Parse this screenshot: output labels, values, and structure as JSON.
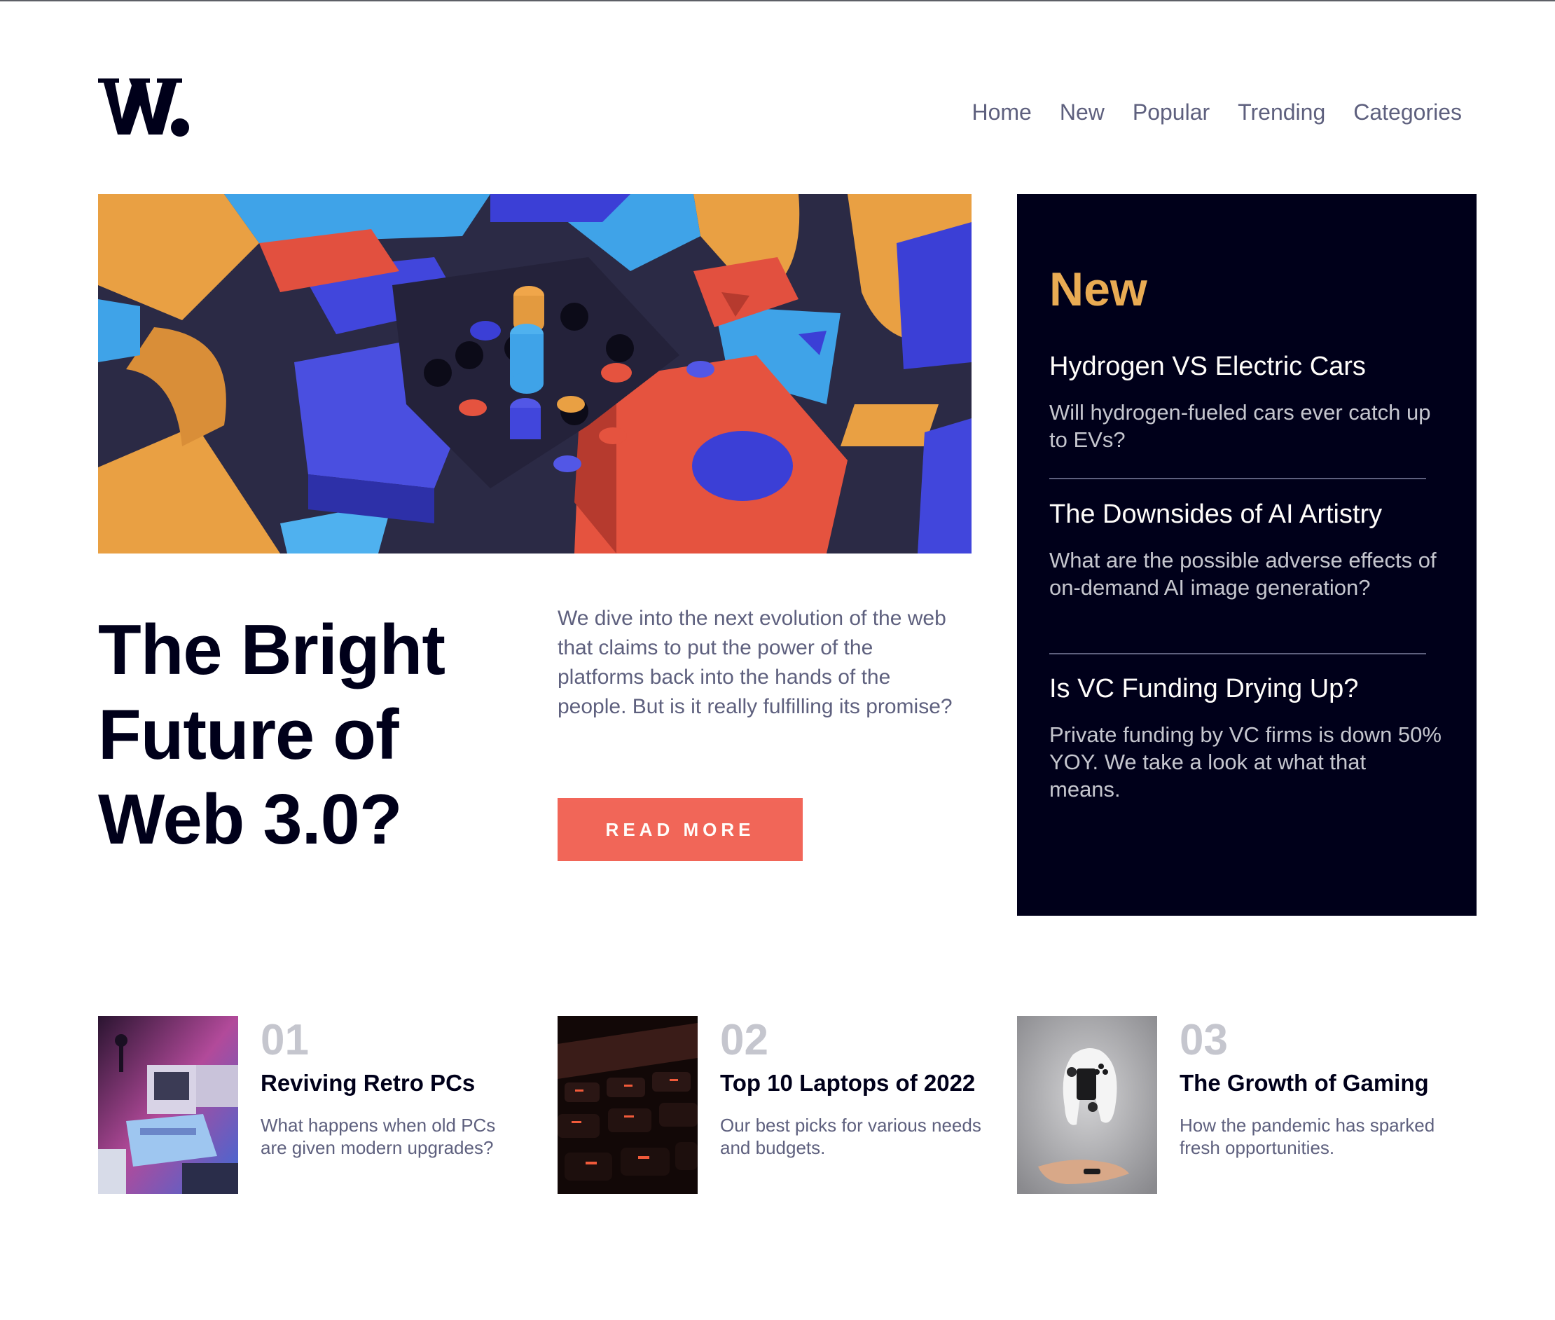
{
  "header": {
    "logo_letter": "W",
    "nav": [
      "Home",
      "New",
      "Popular",
      "Trending",
      "Categories"
    ]
  },
  "hero": {
    "image_alt": "abstract 3D colorful blocks",
    "title": "The Bright Future of Web 3.0?",
    "description": "We dive into the next evolution of the web that claims to put the power of the platforms back into the hands of the people. But is it really fulfilling its promise?",
    "cta_label": "READ MORE"
  },
  "new_panel": {
    "heading": "New",
    "items": [
      {
        "title": "Hydrogen VS Electric Cars",
        "summary": "Will hydrogen-fueled cars ever catch up to EVs?"
      },
      {
        "title": "The Downsides of AI Artistry",
        "summary": "What are the possible adverse effects of on-demand AI image generation?"
      },
      {
        "title": "Is VC Funding Drying Up?",
        "summary": "Private funding by VC firms is down 50% YOY. We take a look at what that means."
      }
    ]
  },
  "articles": [
    {
      "number": "01",
      "title": "Reviving Retro PCs",
      "summary": "What happens when old PCs are given modern upgrades?",
      "image_alt": "retro computers"
    },
    {
      "number": "02",
      "title": "Top 10 Laptops of 2022",
      "summary": "Our best picks for various needs and budgets.",
      "image_alt": "laptop keyboard"
    },
    {
      "number": "03",
      "title": "The Growth of Gaming",
      "summary": "How the pandemic has sparked fresh opportunities.",
      "image_alt": "game controller"
    }
  ],
  "colors": {
    "dark_navy": "#00001a",
    "accent_orange": "#e9ab53",
    "soft_red": "#f15e50",
    "grayish_blue": "#5e607e",
    "off_white": "#fffdfa"
  }
}
